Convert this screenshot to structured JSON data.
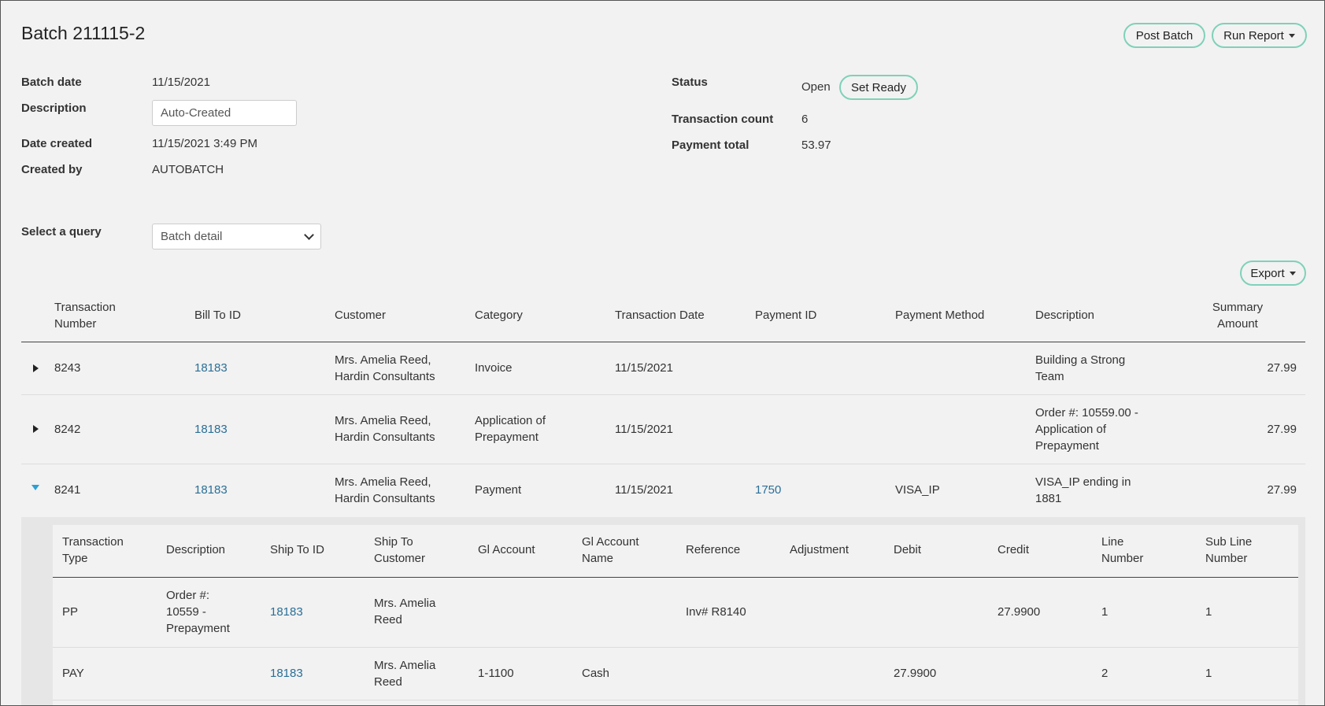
{
  "header": {
    "title": "Batch 211115-2",
    "post_batch_label": "Post Batch",
    "run_report_label": "Run Report"
  },
  "info_left": {
    "batch_date_label": "Batch date",
    "batch_date_value": "11/15/2021",
    "description_label": "Description",
    "description_value": "Auto-Created",
    "date_created_label": "Date created",
    "date_created_value": "11/15/2021 3:49 PM",
    "created_by_label": "Created by",
    "created_by_value": "AUTOBATCH"
  },
  "info_right": {
    "status_label": "Status",
    "status_value": "Open",
    "set_ready_label": "Set Ready",
    "transaction_count_label": "Transaction count",
    "transaction_count_value": "6",
    "payment_total_label": "Payment total",
    "payment_total_value": "53.97"
  },
  "query": {
    "label": "Select a query",
    "selected": "Batch detail"
  },
  "export_label": "Export",
  "table": {
    "headers": {
      "txn_number": [
        "Transaction",
        "Number"
      ],
      "bill_to": "Bill To ID",
      "customer": "Customer",
      "category": "Category",
      "txn_date": "Transaction Date",
      "payment_id": "Payment ID",
      "payment_method": "Payment Method",
      "description": "Description",
      "summary": [
        "Summary",
        "Amount"
      ]
    },
    "rows": [
      {
        "txn": "8243",
        "bill_to": "18183",
        "customer": [
          "Mrs. Amelia Reed,",
          "Hardin Consultants"
        ],
        "category": [
          "Invoice"
        ],
        "date": "11/15/2021",
        "payment_id": "",
        "payment_method": "",
        "description": [
          "Building a Strong",
          "Team"
        ],
        "amount": "27.99",
        "expanded": false
      },
      {
        "txn": "8242",
        "bill_to": "18183",
        "customer": [
          "Mrs. Amelia Reed,",
          "Hardin Consultants"
        ],
        "category": [
          "Application of",
          "Prepayment"
        ],
        "date": "11/15/2021",
        "payment_id": "",
        "payment_method": "",
        "description": [
          "Order #: 10559.00 -",
          "Application of",
          "Prepayment"
        ],
        "amount": "27.99",
        "expanded": false
      },
      {
        "txn": "8241",
        "bill_to": "18183",
        "customer": [
          "Mrs. Amelia Reed,",
          "Hardin Consultants"
        ],
        "category": [
          "Payment"
        ],
        "date": "11/15/2021",
        "payment_id": "1750",
        "payment_method": "VISA_IP",
        "description": [
          "VISA_IP ending in",
          "1881"
        ],
        "amount": "27.99",
        "expanded": true
      }
    ]
  },
  "subtable": {
    "headers": {
      "type": [
        "Transaction",
        "Type"
      ],
      "description": "Description",
      "ship_to_id": "Ship To ID",
      "ship_to_customer": [
        "Ship To",
        "Customer"
      ],
      "gl_account": "Gl Account",
      "gl_account_name": [
        "Gl Account",
        "Name"
      ],
      "reference": "Reference",
      "adjustment": "Adjustment",
      "debit": "Debit",
      "credit": "Credit",
      "line_number": [
        "Line",
        "Number"
      ],
      "sub_line_number": [
        "Sub Line",
        "Number"
      ]
    },
    "rows": [
      {
        "type": "PP",
        "description": [
          "Order #:",
          "10559 -",
          "Prepayment"
        ],
        "ship_to_id": "18183",
        "ship_to_customer": [
          "Mrs. Amelia",
          "Reed"
        ],
        "gl_account": "",
        "gl_account_name": "",
        "reference": "Inv# R8140",
        "adjustment": "",
        "debit": "",
        "credit": "27.9900",
        "line_number": "1",
        "sub_line_number": "1"
      },
      {
        "type": "PAY",
        "description": [],
        "ship_to_id": "18183",
        "ship_to_customer": [
          "Mrs. Amelia",
          "Reed"
        ],
        "gl_account": "1-1100",
        "gl_account_name": "Cash",
        "reference": "",
        "adjustment": "",
        "debit": "27.9900",
        "credit": "",
        "line_number": "2",
        "sub_line_number": "1"
      }
    ]
  }
}
